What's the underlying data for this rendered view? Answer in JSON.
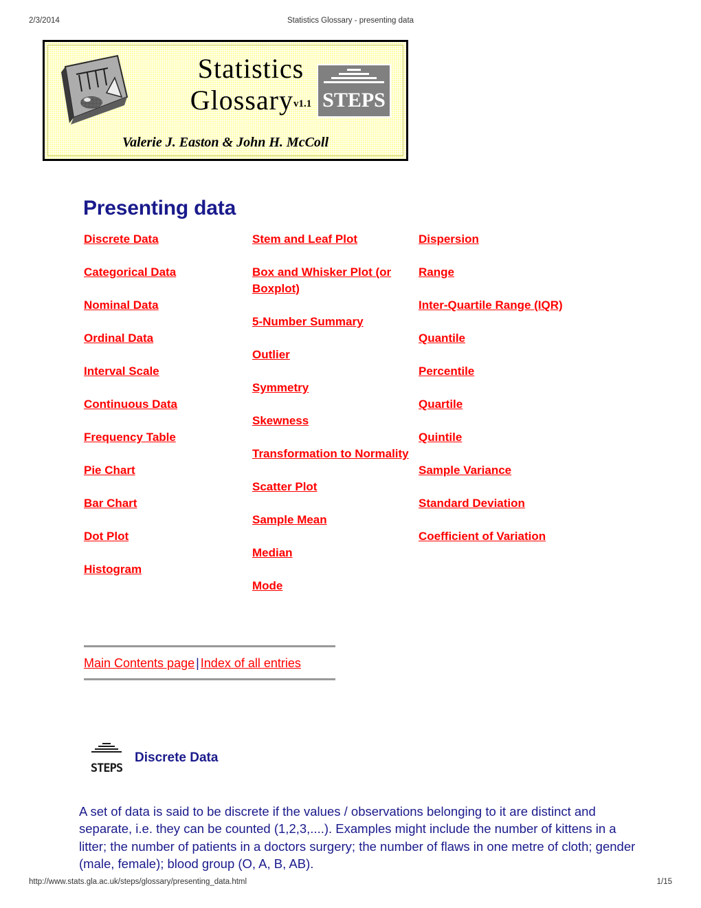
{
  "print_header": {
    "date": "2/3/2014",
    "title": "Statistics Glossary - presenting data"
  },
  "print_footer": {
    "url": "http://www.stats.gla.ac.uk/steps/glossary/presenting_data.html",
    "page": "1/15"
  },
  "banner": {
    "title_line1": "Statistics",
    "title_line2": "Glossary",
    "version": "v1.1",
    "authors": "Valerie J. Easton & John H. McColl",
    "badge_word": "STEPS",
    "background_color": "#FFFFA8",
    "border_color": "#000000",
    "badge_color": "#808080"
  },
  "page_title": "Presenting data",
  "colors": {
    "link": "#FF0000",
    "heading": "#1A1A8C",
    "rule": "#999999"
  },
  "columns": [
    {
      "links": [
        "Discrete Data",
        "Categorical Data",
        "Nominal Data",
        "Ordinal Data",
        "Interval Scale",
        "Continuous Data",
        "Frequency Table",
        "Pie Chart",
        "Bar Chart",
        "Dot Plot",
        "Histogram"
      ]
    },
    {
      "links": [
        "Stem and Leaf Plot",
        "Box and Whisker Plot (or Boxplot)",
        "5-Number Summary",
        "Outlier",
        "Symmetry",
        "Skewness",
        "Transformation to Normality",
        "Scatter Plot",
        "Sample Mean",
        "Median",
        "Mode"
      ]
    },
    {
      "links": [
        "Dispersion",
        "Range",
        "Inter-Quartile Range (IQR)",
        "Quantile",
        "Percentile",
        "Quartile",
        "Quintile",
        "Sample Variance",
        "Standard Deviation",
        "Coefficient of Variation"
      ]
    }
  ],
  "foot_nav": {
    "main_contents": "Main Contents page",
    "separator": "|",
    "index": "Index of all entries"
  },
  "section": {
    "icon_word": "STEPS",
    "title": "Discrete Data",
    "body": "A set of data is said to be discrete if the values / observations belonging to it are distinct and separate, i.e. they can be counted (1,2,3,....). Examples might include the number of kittens in a litter; the number of patients in a doctors surgery; the number of flaws in one metre of cloth; gender (male, female); blood group (O, A, B, AB)."
  }
}
